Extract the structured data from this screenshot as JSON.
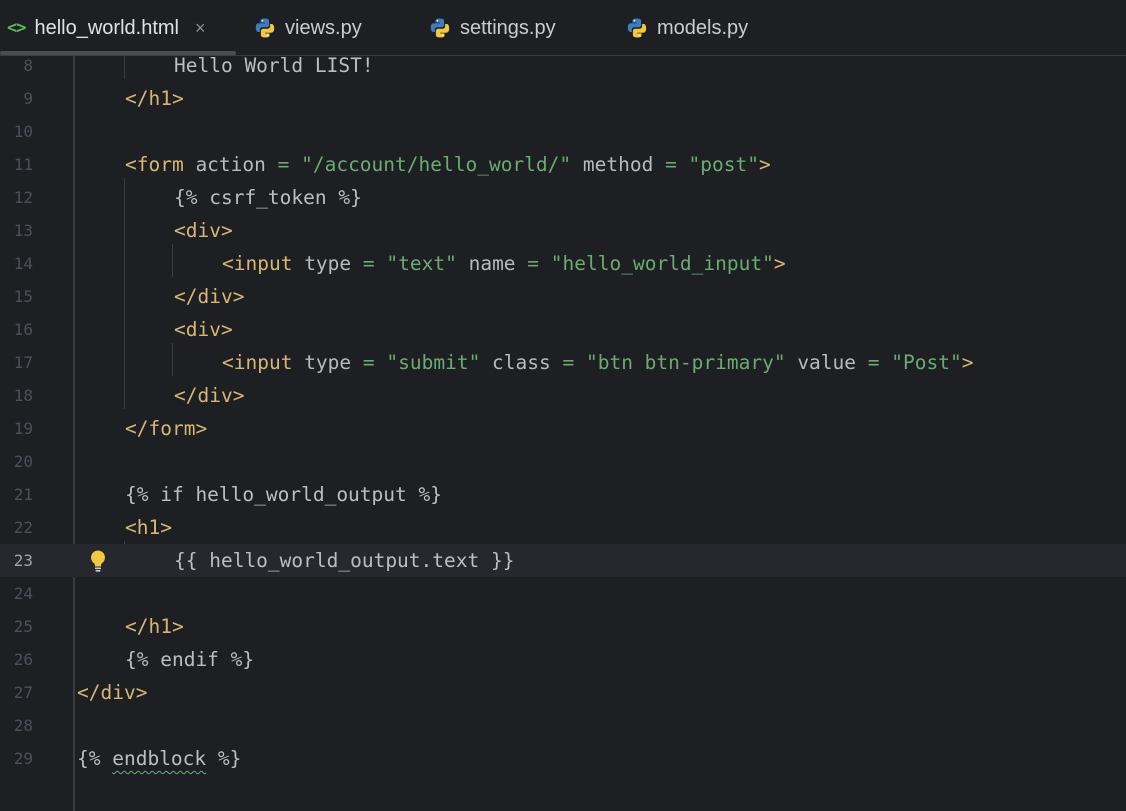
{
  "tabs": [
    {
      "label": "hello_world.html",
      "icon": "html-file-icon",
      "active": true,
      "close": "×"
    },
    {
      "label": "views.py",
      "icon": "python-file-icon"
    },
    {
      "label": "settings.py",
      "icon": "python-file-icon"
    },
    {
      "label": "models.py",
      "icon": "python-file-icon"
    }
  ],
  "html_icon_text": "<>",
  "editor": {
    "current_line": "23",
    "lines": [
      {
        "num": "8"
      },
      {
        "num": "9"
      },
      {
        "num": "10"
      },
      {
        "num": "11"
      },
      {
        "num": "12"
      },
      {
        "num": "13"
      },
      {
        "num": "14"
      },
      {
        "num": "15"
      },
      {
        "num": "16"
      },
      {
        "num": "17"
      },
      {
        "num": "18"
      },
      {
        "num": "19"
      },
      {
        "num": "20"
      },
      {
        "num": "21"
      },
      {
        "num": "22"
      },
      {
        "num": "23"
      },
      {
        "num": "24"
      },
      {
        "num": "25"
      },
      {
        "num": "26"
      },
      {
        "num": "27"
      },
      {
        "num": "28"
      },
      {
        "num": "29"
      }
    ],
    "code": {
      "l8": "Hello World LIST!",
      "l9": "</h1>",
      "l11_tag_open": "<form",
      "l11_attr1": " action ",
      "l11_eq1": "= ",
      "l11_val1": "\"/account/hello_world/\"",
      "l11_attr2": " method ",
      "l11_eq2": "= ",
      "l11_val2": "\"post\"",
      "l11_close": ">",
      "l12": "{% csrf_token %}",
      "l13": "<div>",
      "l14_tag_open": "<input",
      "l14_attr1": " type ",
      "l14_eq1": "= ",
      "l14_val1": "\"text\"",
      "l14_attr2": " name ",
      "l14_eq2": "= ",
      "l14_val2": "\"hello_world_input\"",
      "l14_close": ">",
      "l15": "</div>",
      "l16": "<div>",
      "l17_tag_open": "<input",
      "l17_attr1": " type ",
      "l17_eq1": "= ",
      "l17_val1": "\"submit\"",
      "l17_attr2": " class ",
      "l17_eq2": "= ",
      "l17_val2": "\"btn btn-primary\"",
      "l17_attr3": " value ",
      "l17_eq3": "= ",
      "l17_val3": "\"Post\"",
      "l17_close": ">",
      "l18": "</div>",
      "l19": "</form>",
      "l21": "{% if hello_world_output %}",
      "l22": "<h1>",
      "l23": "{{ hello_world_output.text }}",
      "l25": "</h1>",
      "l26": "{% endif %}",
      "l27": "</div>",
      "l29_open": "{% ",
      "l29_word": "endblock",
      "l29_close": " %}"
    }
  },
  "colors": {
    "tag": "#d5b778",
    "string": "#6aab73",
    "text": "#bcbec4",
    "background": "#1e1f22",
    "current_line": "#26282e"
  }
}
